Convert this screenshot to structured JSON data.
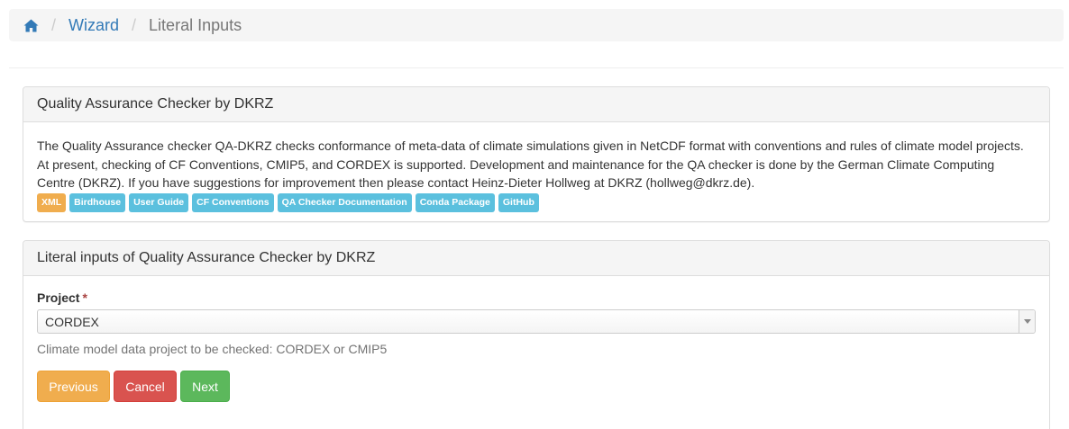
{
  "breadcrumb": {
    "home_icon": "home-icon",
    "items": [
      "Wizard",
      "Literal Inputs"
    ]
  },
  "process_panel": {
    "title": "Quality Assurance Checker by DKRZ",
    "description": "The Quality Assurance checker QA-DKRZ checks conformance of meta-data of climate simulations given in NetCDF format with conventions and rules of climate model projects. At present, checking of CF Conventions, CMIP5, and CORDEX is supported. Development and maintenance for the QA checker is done by the German Climate Computing Centre (DKRZ). If you have suggestions for improvement then please contact Heinz-Dieter Hollweg at DKRZ (hollweg@dkrz.de).",
    "labels": [
      {
        "text": "XML",
        "color": "#f0ad4e"
      },
      {
        "text": "Birdhouse",
        "color": "#5bc0de"
      },
      {
        "text": "User Guide",
        "color": "#5bc0de"
      },
      {
        "text": "CF Conventions",
        "color": "#5bc0de"
      },
      {
        "text": "QA Checker Documentation",
        "color": "#5bc0de"
      },
      {
        "text": "Conda Package",
        "color": "#5bc0de"
      },
      {
        "text": "GitHub",
        "color": "#5bc0de"
      }
    ]
  },
  "inputs_panel": {
    "title": "Literal inputs of Quality Assurance Checker by DKRZ",
    "project_label": "Project",
    "required_marker": "*",
    "project_value": "CORDEX",
    "project_help": "Climate model data project to be checked: CORDEX or CMIP5",
    "buttons": {
      "previous": "Previous",
      "cancel": "Cancel",
      "next": "Next"
    }
  },
  "colors": {
    "link": "#337ab7",
    "warning": "#f0ad4e",
    "danger": "#d9534f",
    "success": "#5cb85c",
    "info": "#5bc0de"
  }
}
